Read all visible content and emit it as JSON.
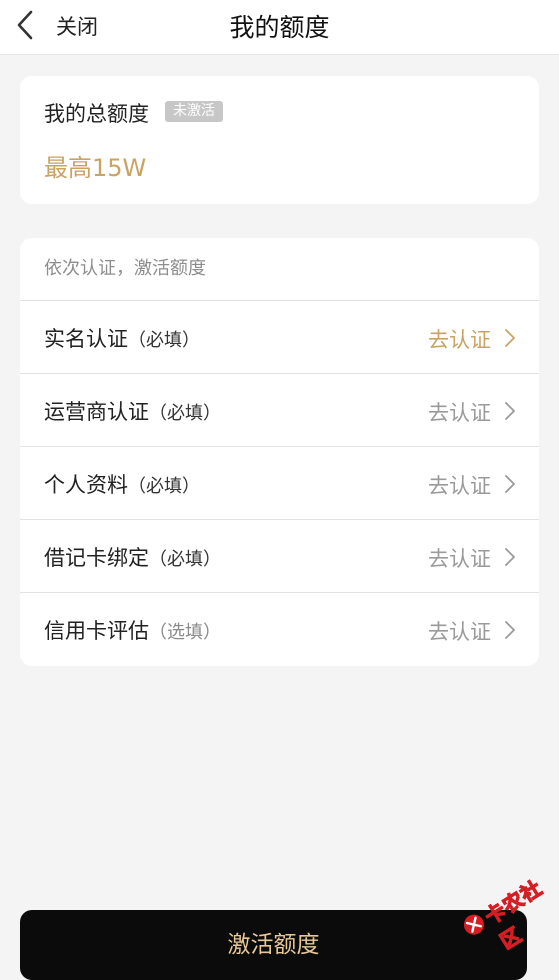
{
  "nav": {
    "back_icon": "chevron-left-icon",
    "close_label": "关闭",
    "title": "我的额度"
  },
  "total": {
    "label": "我的总额度",
    "badge": "未激活",
    "value": "最高15W"
  },
  "verification": {
    "header": "依次认证，激活额度",
    "items": [
      {
        "title": "实名认证",
        "tag": "（必填）",
        "action": "去认证",
        "highlighted": true
      },
      {
        "title": "运营商认证",
        "tag": "（必填）",
        "action": "去认证",
        "highlighted": false
      },
      {
        "title": "个人资料",
        "tag": "（必填）",
        "action": "去认证",
        "highlighted": false
      },
      {
        "title": "借记卡绑定",
        "tag": "（必填）",
        "action": "去认证",
        "highlighted": false
      },
      {
        "title": "信用卡评估",
        "tag": "（选填）",
        "action": "去认证",
        "highlighted": false
      }
    ]
  },
  "cta": {
    "label": "激活额度"
  },
  "watermark": {
    "text": "卡农社区"
  },
  "colors": {
    "accent_gold": "#c9a363",
    "cta_background": "#0b0b0b",
    "cta_text": "#e8c896",
    "badge_gray": "#c7c7c7",
    "muted_text": "#9a9a9a",
    "watermark_red": "#d51d24"
  }
}
